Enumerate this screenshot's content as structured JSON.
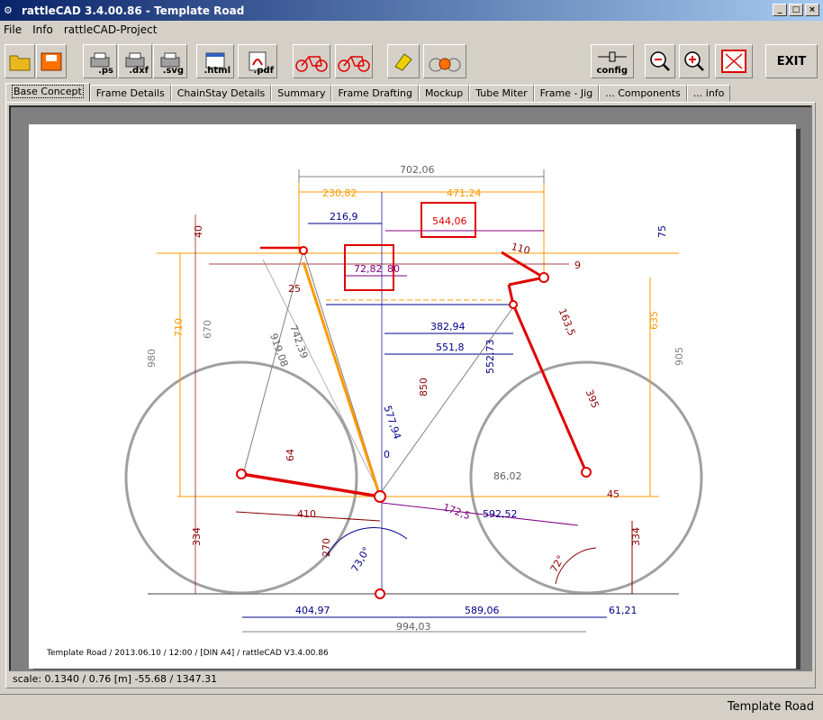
{
  "window": {
    "title": "rattleCAD  3.4.00.86 - Template Road"
  },
  "menu": {
    "items": [
      "File",
      "Info",
      "rattleCAD-Project"
    ]
  },
  "toolbar": {
    "ps": ".ps",
    "dxf": ".dxf",
    "svg": ".svg",
    "html": ".html",
    "pdf": ".pdf",
    "config": "config",
    "exit": "EXIT"
  },
  "tabs": [
    "Base Concept",
    "Frame Details",
    "ChainStay Details",
    "Summary",
    "Frame Drafting",
    "Mockup",
    "Tube Miter",
    "Frame - Jig",
    "... Components",
    "... info"
  ],
  "drawing": {
    "dims": {
      "top_total": "702,06",
      "top_left": "230,82",
      "top_right": "471,24",
      "saddle_x": "216,9",
      "reach": "544,06",
      "stack_top": "75",
      "seat_left": "40",
      "head_angle_box": "72,82",
      "head_small": "80",
      "seat_off": "25",
      "seat_tube_len": "742,39",
      "diag": "919,08",
      "st_len": "670",
      "saddle_h": "980",
      "orange_h": "710",
      "stem": "110",
      "stem_angle": "9",
      "ht_len": "163,5",
      "fork_len": "395",
      "right_h": "905",
      "orange_r": "635",
      "tt_h": "382,94",
      "tt_eff": "551,8",
      "drop_len": "552,73",
      "bb_sad": "850",
      "seat_tube_cut": "577,94",
      "cs_small": "64",
      "zero": "0",
      "cs_len": "410",
      "bb_angle": "172,5",
      "fc": "592,52",
      "bb_drop": "86,02",
      "trail": "45",
      "left_wheel_h": "334",
      "right_wheel_h": "334",
      "bb_h": "270",
      "seat_ang": "73,0°",
      "head_ang": "72°",
      "wb_left": "404,97",
      "wb_right": "589,06",
      "wb_total": "994,03",
      "overhang": "61,21"
    },
    "stamp": "Template Road   /   2013.06.10 / 12:00   /  [DIN A4]  /   rattleCAD   V3.4.00.86"
  },
  "status": {
    "scale": "scale: 0.1340 / 0.76  [m]  -55.68 / 1347.31",
    "project": "Template Road"
  },
  "colors": {
    "frame": "#e00000",
    "orange": "#ff9900",
    "blue": "#00008b",
    "purple": "#800080",
    "wheel": "#a0a0a0"
  }
}
